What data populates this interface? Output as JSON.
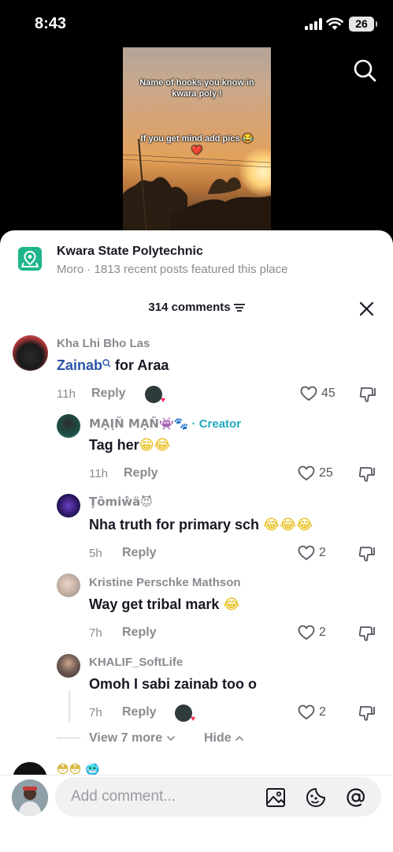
{
  "status": {
    "time": "8:43",
    "battery": "26"
  },
  "video": {
    "line1": "Name of hooks you know in",
    "line2": "kwara poly !",
    "line3": "If you get mind add pics 😂",
    "line4": "❤️"
  },
  "place": {
    "title": "Kwara State Polytechnic",
    "subtitle": "Moro · 1813 recent posts featured this place"
  },
  "comments_header": {
    "count": "314 comments"
  },
  "comments": [
    {
      "user": "Kha Lhi Bho Las",
      "mention": "Zainab",
      "text": " for Araa",
      "time": "11h",
      "reply": "Reply",
      "likes": "45"
    },
    {
      "user": "MẠĮÑ MẠÑ👾🐾",
      "creator_sep": " · ",
      "creator": "Creator",
      "text": "Tag her",
      "emoji": "😁😂",
      "time": "11h",
      "reply": "Reply",
      "likes": "25"
    },
    {
      "user": "Ţômiŵä😈",
      "text": "Nha truth for primary sch ",
      "emoji": "😂😂😂",
      "time": "5h",
      "reply": "Reply",
      "likes": "2"
    },
    {
      "user": "Kristine Perschke Mathson",
      "text": "Way get tribal mark ",
      "emoji": "😂",
      "time": "7h",
      "reply": "Reply",
      "likes": "2"
    },
    {
      "user": "KHALIF_SoftLife",
      "text": "Omoh I sabi zainab too o",
      "time": "7h",
      "reply": "Reply",
      "likes": "2"
    }
  ],
  "view_more": "View 7 more",
  "hide": "Hide",
  "peek": "😳😳 🥶",
  "composer": {
    "placeholder": "Add comment..."
  }
}
